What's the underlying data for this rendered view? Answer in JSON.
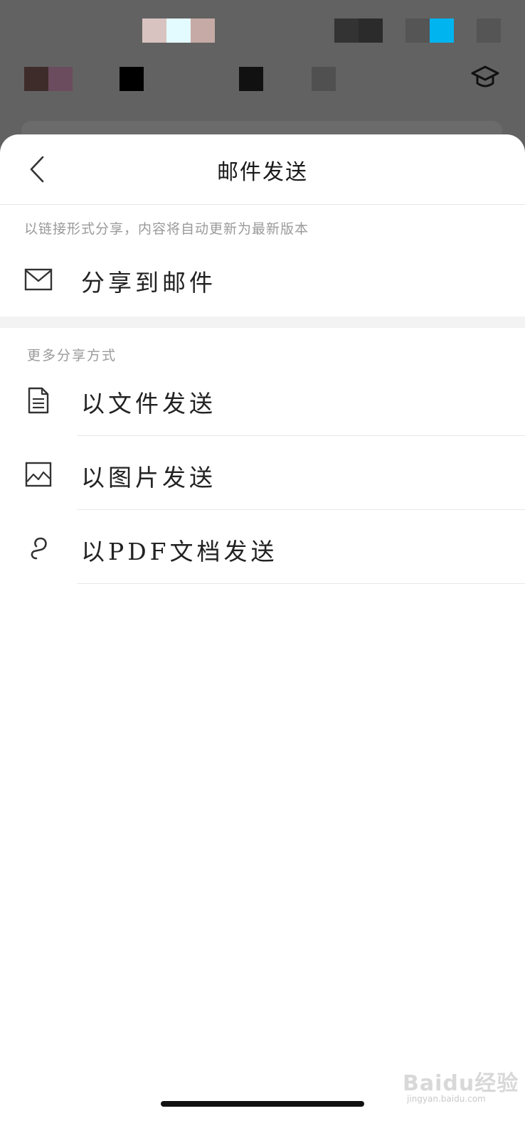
{
  "sheet": {
    "title": "邮件发送",
    "link_share_hint": "以链接形式分享，内容将自动更新为最新版本",
    "share_to_email_label": "分享到邮件",
    "more_options_label": "更多分享方式",
    "options": [
      {
        "label": "以文件发送",
        "icon": "document-icon"
      },
      {
        "label": "以图片发送",
        "icon": "image-icon"
      },
      {
        "label": "以PDF文档发送",
        "icon": "pdf-icon"
      }
    ]
  },
  "background": {
    "icon": "graduation-cap-icon"
  },
  "watermark": {
    "brand": "Baidu经验",
    "url": "jingyan.baidu.com"
  },
  "colors": {
    "overlay": "#5f5f5f",
    "sheet": "#ffffff",
    "text": "#222222",
    "hint": "#9a9a9a",
    "accent_blue": "#00b4f0"
  }
}
